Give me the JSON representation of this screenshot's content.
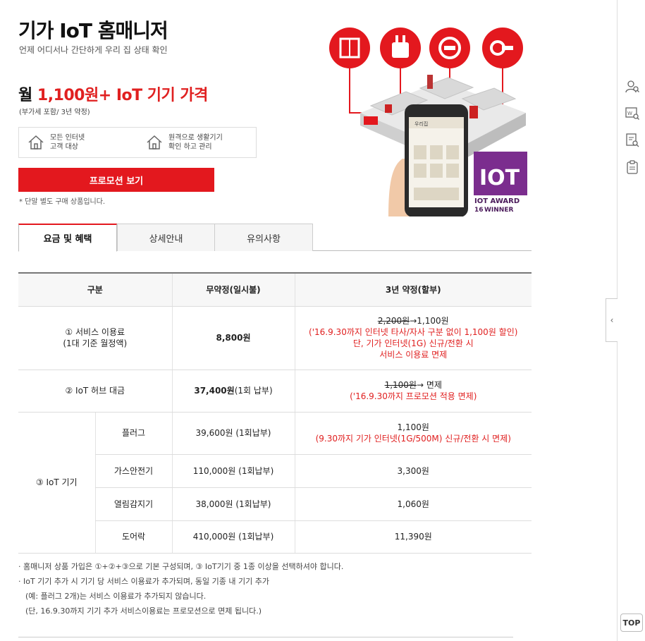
{
  "product": {
    "title": "기가 IoT 홈매니저",
    "subtitle": "언제 어디서나 간단하게 우리 집 상태 확인",
    "price_prefix": "월 ",
    "price_value": "1,100원+ IoT 기기 가격",
    "price_note": "(부가세 포함/ 3년 약정)",
    "benefits": [
      {
        "line1": "모든 인터넷",
        "line2": "고객 대상"
      },
      {
        "line1": "원격으로 생활기기",
        "line2": "확인 하고 관리"
      }
    ],
    "promo_button": "프로모션 보기",
    "device_note": "* 단말 별도 구매 상품입니다."
  },
  "hero": {
    "phone_title": "우리집",
    "badge_big": "IOT",
    "badge_line1": "IOT AWARD",
    "badge_year": "16",
    "badge_line2": "WINNER",
    "accent_color": "#e3181e",
    "badge_color": "#7b2d8e"
  },
  "tabs": [
    {
      "label": "요금 및 혜택",
      "active": true
    },
    {
      "label": "상세안내",
      "active": false
    },
    {
      "label": "유의사항",
      "active": false
    }
  ],
  "table": {
    "headers": [
      "구분",
      "무약정(일시불)",
      "3년 약정(할부)"
    ],
    "row1": {
      "cat1": "① 서비스 이용료",
      "cat2": "(1대 기준 월정액)",
      "no_contract": "8,800원",
      "old_price": "2,200원",
      "arrow_price": "→1,100원",
      "red1": "('16.9.30까지 인터넷 타사/자사 구분 없이 1,100원 할인)",
      "red2": "단, 기가 인터넷(1G) 신규/전환 시",
      "red3": "서비스 이용료 면제"
    },
    "row2": {
      "cat": "② IoT 허브 대금",
      "no_contract_bold": "37,400원",
      "no_contract_rest": "(1회 납부)",
      "old_price": "1,100원",
      "arrow_price": "→ 면제",
      "red": "('16.9.30까지 프로모션 적용 면제)"
    },
    "iot_label": "③ IoT 기기",
    "devices": [
      {
        "name": "플러그",
        "no_contract": "39,600원 (1회납부)",
        "contract": "1,100원",
        "red": "(9.30까지 기가 인터넷(1G/500M) 신규/전환 시 면제)"
      },
      {
        "name": "가스안전기",
        "no_contract": "110,000원 (1회납부)",
        "contract": "3,300원"
      },
      {
        "name": "열림감지기",
        "no_contract": "38,000원 (1회납부)",
        "contract": "1,060원"
      },
      {
        "name": "도어락",
        "no_contract": "410,000원 (1회납부)",
        "contract": "11,390원"
      }
    ]
  },
  "notes": [
    "·  홈매니저 상품 가입은 ①+②+③으로 기본 구성되며, ③ IoT기기 중 1종 이상을 선택하셔야 합니다.",
    "·  IoT 기기 추가 시 기기 당 서비스 이용료가 추가되며, 동일 기종 내 기기 추가",
    "(예: 플러그 2개)는 서비스 이용료가 추가되지 않습니다.",
    "(단, 16.9.30까지 기기 추가 서비스이용료는 프로모션으로 면제 됩니다.)"
  ],
  "rail": {
    "top_label": "TOP",
    "toggle_glyph": "‹",
    "icons": [
      "user-search-icon",
      "web-search-icon",
      "doc-search-icon",
      "clipboard-icon"
    ]
  }
}
